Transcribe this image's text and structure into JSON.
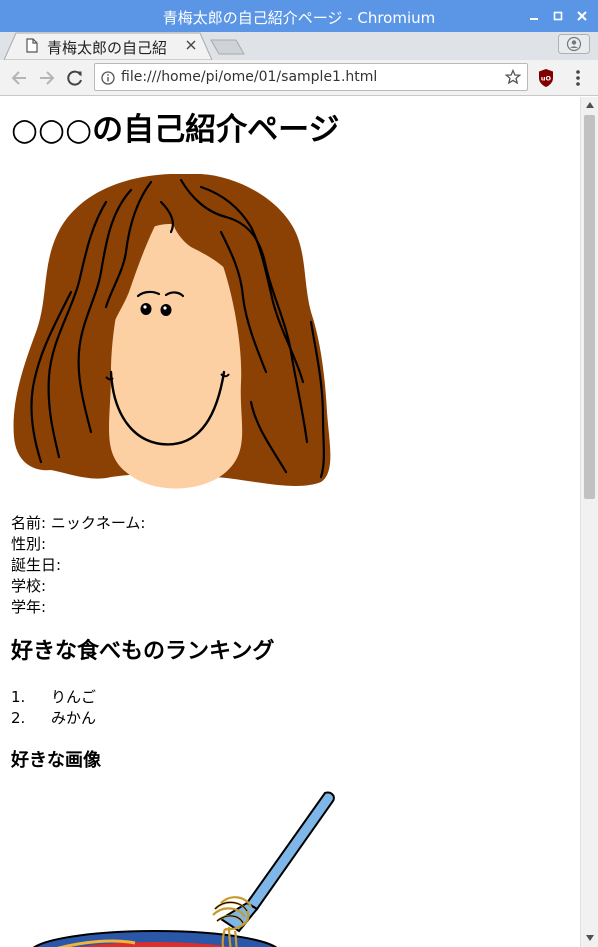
{
  "window": {
    "title": "青梅太郎の自己紹介ページ - Chromium"
  },
  "tab": {
    "title": "青梅太郎の自己紹"
  },
  "toolbar": {
    "url": "file:///home/pi/ome/01/sample1.html"
  },
  "page": {
    "heading": "○○○の自己紹介ページ",
    "profile": [
      "名前: ニックネーム:",
      "性別:",
      "誕生日:",
      "学校:",
      "学年:"
    ],
    "ranking_heading": "好きな食べものランキング",
    "ranking": [
      {
        "num": "1.",
        "item": "りんご"
      },
      {
        "num": "2.",
        "item": "みかん"
      }
    ],
    "image_heading": "好きな画像"
  },
  "icons": {
    "minimize": "minimize-icon",
    "maximize": "maximize-icon",
    "close": "close-icon",
    "document": "document-icon",
    "back": "back-arrow-icon",
    "forward": "forward-arrow-icon",
    "reload": "reload-icon",
    "info": "info-icon",
    "star": "star-icon",
    "extension": "ublock-icon",
    "menu": "kebab-menu-icon",
    "profile": "profile-icon"
  },
  "colors": {
    "titlebar": "#5b96e6",
    "tabstrip": "#dfe3e8",
    "toolbar": "#f2f2f2",
    "hair": "#8b4104",
    "skin": "#fdd0a4"
  }
}
